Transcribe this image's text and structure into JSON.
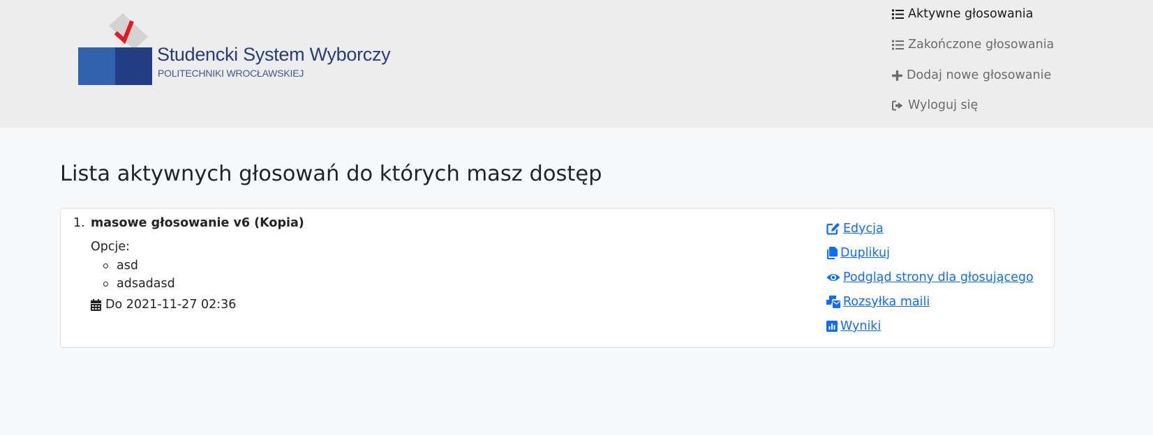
{
  "brand": {
    "title": "Studencki System Wyborczy",
    "subtitle": "POLITECHNIKI WROCŁAWSKIEJ",
    "colors": {
      "blue_light": "#3262ab",
      "blue_dark": "#223f85",
      "check_red": "#e01b24",
      "paper": "#d3d3d3"
    }
  },
  "nav": {
    "items": [
      {
        "label": "Aktywne głosowania",
        "icon": "list-icon",
        "active": true
      },
      {
        "label": "Zakończone głosowania",
        "icon": "list-icon",
        "active": false
      },
      {
        "label": "Dodaj nowe głosowanie",
        "icon": "plus-icon",
        "active": false
      },
      {
        "label": "Wyloguj się",
        "icon": "logout-icon",
        "active": false
      }
    ]
  },
  "main": {
    "title": "Lista aktywnych głosowań do których masz dostęp",
    "votings": [
      {
        "number": "1.",
        "title": "masowe głosowanie v6 (Kopia)",
        "options_label": "Opcje:",
        "options": [
          "asd",
          "adsadasd"
        ],
        "deadline": "Do 2021-11-27 02:36",
        "deadline_icon": "calendar-icon",
        "actions": [
          {
            "label": " Edycja",
            "icon": "edit-icon"
          },
          {
            "label": " Duplikuj",
            "icon": "copy-icon"
          },
          {
            "label": " Podgląd strony dla głosującego",
            "icon": "eye-icon"
          },
          {
            "label": " Rozsyłka maili",
            "icon": "mail-bulk-icon"
          },
          {
            "label": " Wyniki",
            "icon": "chart-icon"
          }
        ]
      }
    ]
  },
  "colors": {
    "link": "#0d6efd",
    "header_bg": "#ededed",
    "page_bg": "#f8f9fa"
  }
}
